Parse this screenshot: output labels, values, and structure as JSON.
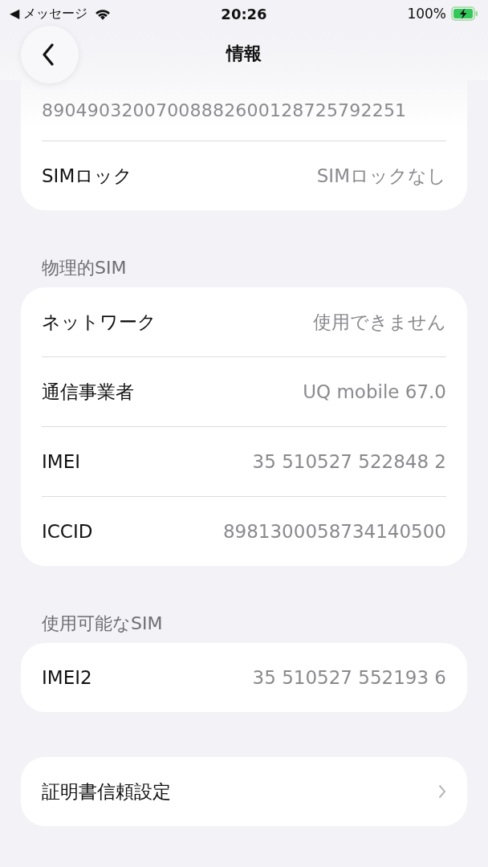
{
  "status_bar": {
    "back_app": "◀ メッセージ",
    "time": "20:26",
    "battery": "100%",
    "charging": true
  },
  "nav": {
    "title": "情報"
  },
  "top_card": {
    "value": "89049032007008882600128725792251",
    "rows": [
      {
        "label": "SIMロック",
        "value": "SIMロックなし"
      }
    ]
  },
  "sections": [
    {
      "header": "物理的SIM",
      "rows": [
        {
          "label": "ネットワーク",
          "value": "使用できません"
        },
        {
          "label": "通信事業者",
          "value": "UQ mobile 67.0"
        },
        {
          "label": "IMEI",
          "value": "35 510527 522848 2"
        },
        {
          "label": "ICCID",
          "value": "8981300058734140500"
        }
      ]
    },
    {
      "header": "使用可能なSIM",
      "rows": [
        {
          "label": "IMEI2",
          "value": "35 510527 552193 6"
        }
      ]
    }
  ],
  "link": {
    "label": "証明書信頼設定"
  }
}
